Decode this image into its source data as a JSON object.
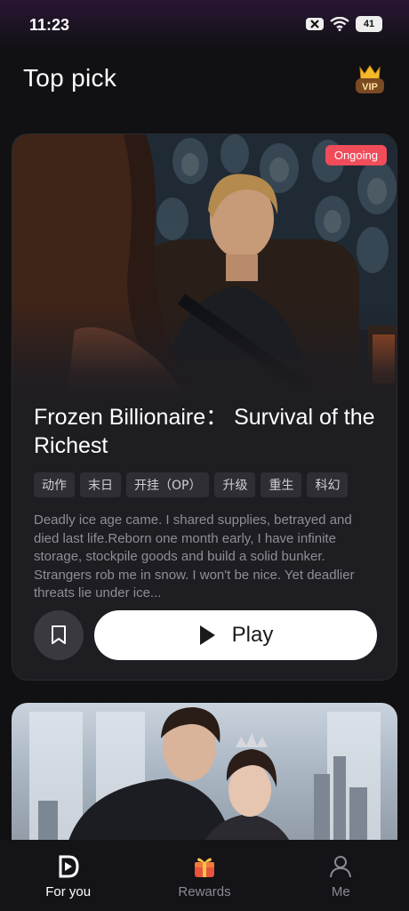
{
  "status_bar": {
    "time": "11:23",
    "battery": "41"
  },
  "header": {
    "title": "Top pick",
    "vip_label": "VIP"
  },
  "card": {
    "status_tag": "Ongoing",
    "title": "Frozen Billionaire： Survival of the Richest",
    "tags": [
      "动作",
      "末日",
      "开挂（OP）",
      "升级",
      "重生",
      "科幻"
    ],
    "description": "Deadly ice age came. I shared supplies, betrayed and died last life.Reborn one month early, I have infinite storage, stockpile goods and build a solid bunker. Strangers rob me in snow. I won't be nice. Yet deadlier threats lie under ice...",
    "play_label": "Play"
  },
  "bottom_nav": {
    "items": [
      {
        "label": "For you",
        "icon": "for-you-logo-icon",
        "active": true
      },
      {
        "label": "Rewards",
        "icon": "gift-icon",
        "active": false
      },
      {
        "label": "Me",
        "icon": "person-icon",
        "active": false
      }
    ]
  },
  "colors": {
    "background": "#111013",
    "card": "#1e1d22",
    "ongoing_tag": "#f04c5a",
    "play_button": "#ffffff"
  }
}
